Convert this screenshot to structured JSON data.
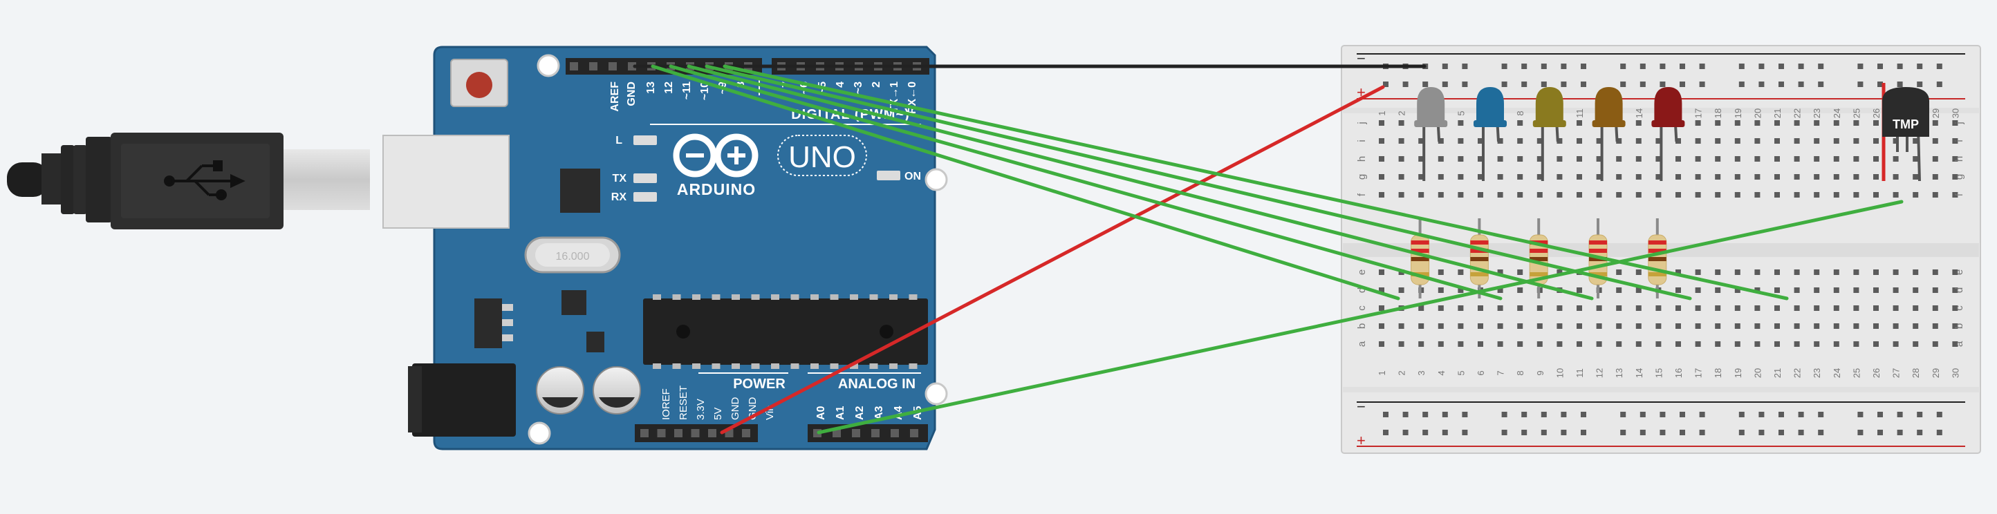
{
  "canvas": {
    "background": "#f2f4f6"
  },
  "arduino": {
    "brand": "ARDUINO",
    "model": "UNO",
    "digital_label": "DIGITAL (PWM~)",
    "power_label": "POWER",
    "analog_label": "ANALOG IN",
    "on_label": "ON",
    "l_label": "L",
    "tx_label": "TX",
    "rx_label": "RX",
    "crystal_label": "16.000",
    "board_color": "#2d6d9c",
    "digital_pins": [
      "AREF",
      "GND",
      "13",
      "12",
      "~11",
      "~10",
      "~9",
      "8",
      "7",
      "~6",
      "~5",
      "4",
      "~3",
      "2",
      "TX→1",
      "RX←0"
    ],
    "power_pins": [
      "IOREF",
      "RESET",
      "3.3V",
      "5V",
      "GND",
      "GND",
      "Vin"
    ],
    "analog_pins": [
      "A0",
      "A1",
      "A2",
      "A3",
      "A4",
      "A5"
    ]
  },
  "breadboard": {
    "column_numbers": [
      "1",
      "2",
      "3",
      "4",
      "5",
      "6",
      "7",
      "8",
      "9",
      "10",
      "11",
      "12",
      "13",
      "14",
      "15",
      "16",
      "17",
      "18",
      "19",
      "20",
      "21",
      "22",
      "23",
      "24",
      "25",
      "26",
      "27",
      "28",
      "29",
      "30"
    ],
    "row_letters_top": [
      "j",
      "i",
      "h",
      "g",
      "f"
    ],
    "row_letters_bottom": [
      "e",
      "d",
      "c",
      "b",
      "a"
    ],
    "rail_minus": "−",
    "rail_plus": "+"
  },
  "components": {
    "leds": [
      {
        "name": "gray",
        "color": "#8f8f8f"
      },
      {
        "name": "blue",
        "color": "#1f6c9b"
      },
      {
        "name": "yellow",
        "color": "#8a7a1f"
      },
      {
        "name": "orange",
        "color": "#8a5c14"
      },
      {
        "name": "red",
        "color": "#8a1818"
      }
    ],
    "sensor_label": "TMP"
  },
  "wires": {
    "colors": {
      "black": "#222222",
      "red": "#d62828",
      "green": "#3fae3f"
    }
  }
}
